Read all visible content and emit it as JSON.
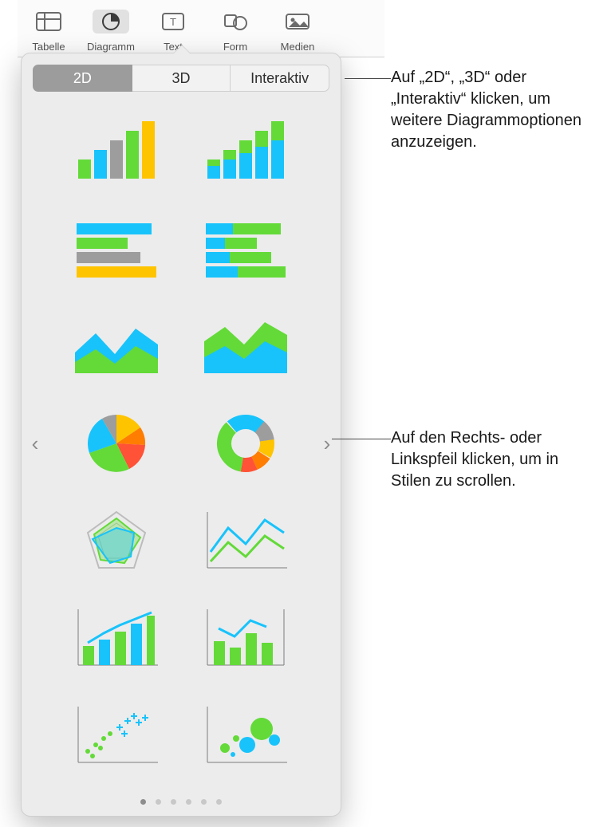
{
  "toolbar": {
    "items": [
      {
        "label": "Tabelle",
        "icon": "table-icon"
      },
      {
        "label": "Diagramm",
        "icon": "chart-icon",
        "selected": true
      },
      {
        "label": "Text",
        "icon": "text-icon"
      },
      {
        "label": "Form",
        "icon": "shape-icon"
      },
      {
        "label": "Medien",
        "icon": "media-icon"
      }
    ]
  },
  "popover": {
    "segments": [
      {
        "label": "2D",
        "selected": true
      },
      {
        "label": "3D"
      },
      {
        "label": "Interaktiv"
      }
    ],
    "nav": {
      "prev": "‹",
      "next": "›"
    },
    "pages": {
      "count": 6,
      "active_index": 0
    },
    "tiles": [
      {
        "name": "bar-chart",
        "kind": "bars"
      },
      {
        "name": "stacked-bar-chart",
        "kind": "stacked-bars"
      },
      {
        "name": "horizontal-bar-chart",
        "kind": "hbars"
      },
      {
        "name": "stacked-horizontal-bar-chart",
        "kind": "stacked-hbars"
      },
      {
        "name": "area-chart",
        "kind": "area"
      },
      {
        "name": "stacked-area-chart",
        "kind": "stacked-area"
      },
      {
        "name": "pie-chart",
        "kind": "pie"
      },
      {
        "name": "donut-chart",
        "kind": "donut"
      },
      {
        "name": "radar-chart",
        "kind": "radar"
      },
      {
        "name": "line-chart",
        "kind": "line"
      },
      {
        "name": "combo-chart",
        "kind": "combo"
      },
      {
        "name": "combo-axes-chart",
        "kind": "combo2"
      },
      {
        "name": "scatter-chart",
        "kind": "scatter"
      },
      {
        "name": "bubble-chart",
        "kind": "bubble"
      }
    ]
  },
  "callouts": {
    "top": "Auf „2D“, „3D“ oder „Interaktiv“ klicken, um weitere Diagrammoptionen anzuzeigen.",
    "mid": "Auf den Rechts- oder Linkspfeil klicken, um in Stilen zu scrollen."
  },
  "colors": {
    "green": "#63da38",
    "blue": "#18c3fb",
    "gray": "#9d9d9d",
    "yellow": "#ffc400",
    "orange": "#ff7d00",
    "red": "#ff5236"
  }
}
